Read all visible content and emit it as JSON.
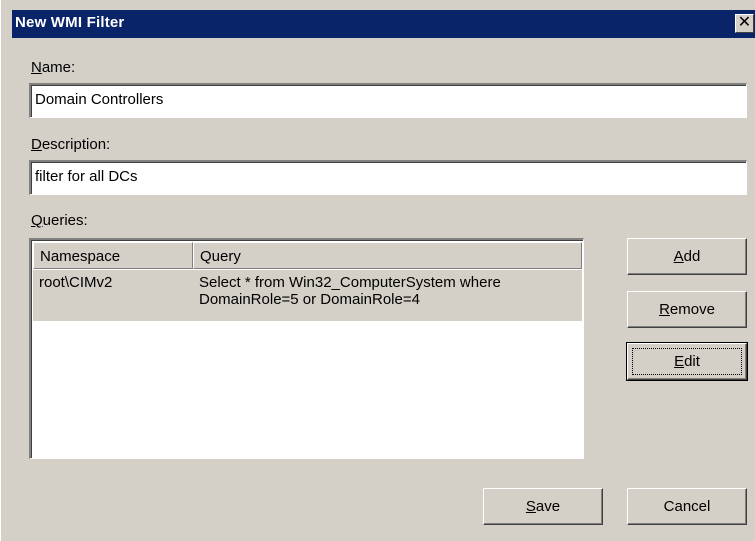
{
  "window": {
    "title": "New WMI Filter",
    "close_glyph": "✕"
  },
  "name_field": {
    "label": "Name:",
    "value": "Domain Controllers"
  },
  "description_field": {
    "label": "Description:",
    "value": "filter for all DCs"
  },
  "queries": {
    "label": "Queries:",
    "columns": [
      "Namespace",
      "Query"
    ],
    "rows": [
      {
        "namespace": "root\\CIMv2",
        "query_line1": "Select * from Win32_ComputerSystem where",
        "query_line2": "DomainRole=5 or DomainRole=4"
      }
    ]
  },
  "buttons": {
    "add": "Add",
    "remove": "Remove",
    "edit": "Edit",
    "save": "Save",
    "cancel": "Cancel"
  },
  "colors": {
    "title_bar": "#0a246a",
    "dialog_face": "#d4d0c8"
  }
}
